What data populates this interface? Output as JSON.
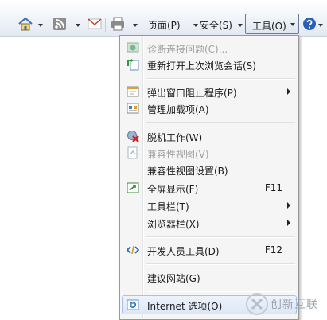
{
  "toolbar": {
    "page_label": "页面(P)",
    "safety_label": "安全(S)",
    "tools_label": "工具(O)"
  },
  "menu": {
    "items": [
      {
        "label": "诊断连接问题(C)...",
        "shortcut": "",
        "disabled": true,
        "icon": "diagnose-icon"
      },
      {
        "label": "重新打开上次浏览会话(S)",
        "shortcut": "",
        "disabled": false,
        "icon": "reopen-session-icon"
      },
      {
        "label": "弹出窗口阻止程序(P)",
        "shortcut": "",
        "disabled": false,
        "icon": "popup-blocker-icon"
      },
      {
        "label": "管理加载项(A)",
        "shortcut": "",
        "disabled": false,
        "icon": "addons-icon"
      },
      {
        "label": "脱机工作(W)",
        "shortcut": "",
        "disabled": false,
        "icon": "work-offline-icon"
      },
      {
        "label": "兼容性视图(V)",
        "shortcut": "",
        "disabled": true,
        "icon": "compat-view-icon"
      },
      {
        "label": "兼容性视图设置(B)",
        "shortcut": "",
        "disabled": false,
        "icon": ""
      },
      {
        "label": "全屏显示(F)",
        "shortcut": "F11",
        "disabled": false,
        "icon": "fullscreen-icon"
      },
      {
        "label": "工具栏(T)",
        "shortcut": "",
        "disabled": false,
        "icon": ""
      },
      {
        "label": "浏览器栏(X)",
        "shortcut": "",
        "disabled": false,
        "icon": ""
      },
      {
        "label": "开发人员工具(D)",
        "shortcut": "F12",
        "disabled": false,
        "icon": "developer-tools-icon"
      },
      {
        "label": "建议网站(G)",
        "shortcut": "",
        "disabled": false,
        "icon": ""
      },
      {
        "label": "Internet 选项(O)",
        "shortcut": "",
        "disabled": false,
        "icon": "internet-options-icon"
      }
    ]
  },
  "watermark": {
    "text": "创新互联"
  }
}
